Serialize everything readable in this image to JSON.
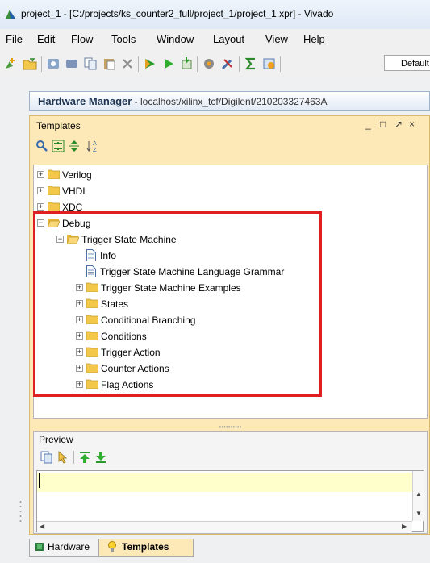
{
  "window": {
    "title": "project_1 - [C:/projects/ks_counter2_full/project_1/project_1.xpr] - Vivado"
  },
  "menu": [
    "File",
    "Edit",
    "Flow",
    "Tools",
    "Window",
    "Layout",
    "View",
    "Help"
  ],
  "toolbar": {
    "layout_combo": "Default"
  },
  "hardware_manager": {
    "title": "Hardware Manager",
    "target": " - localhost/xilinx_tcf/Digilent/210203327463A"
  },
  "templates_panel": {
    "title": "Templates",
    "controls": [
      "_",
      "□",
      "↗",
      "×"
    ]
  },
  "tree": {
    "verilog": "Verilog",
    "vhdl": "VHDL",
    "xdc": "XDC",
    "debug": "Debug",
    "tsm": "Trigger State Machine",
    "info": "Info",
    "grammar": "Trigger State Machine Language Grammar",
    "examples": "Trigger State Machine Examples",
    "states": "States",
    "cond_branching": "Conditional Branching",
    "conditions": "Conditions",
    "trigger_action": "Trigger Action",
    "counter_actions": "Counter Actions",
    "flag_actions": "Flag Actions"
  },
  "preview": {
    "title": "Preview",
    "editor_text": ""
  },
  "tabs": {
    "hardware": "Hardware",
    "templates": "Templates"
  },
  "colors": {
    "panel_bg": "#fde9b8",
    "highlight": "#e02020",
    "folder": "#f2c74a"
  }
}
